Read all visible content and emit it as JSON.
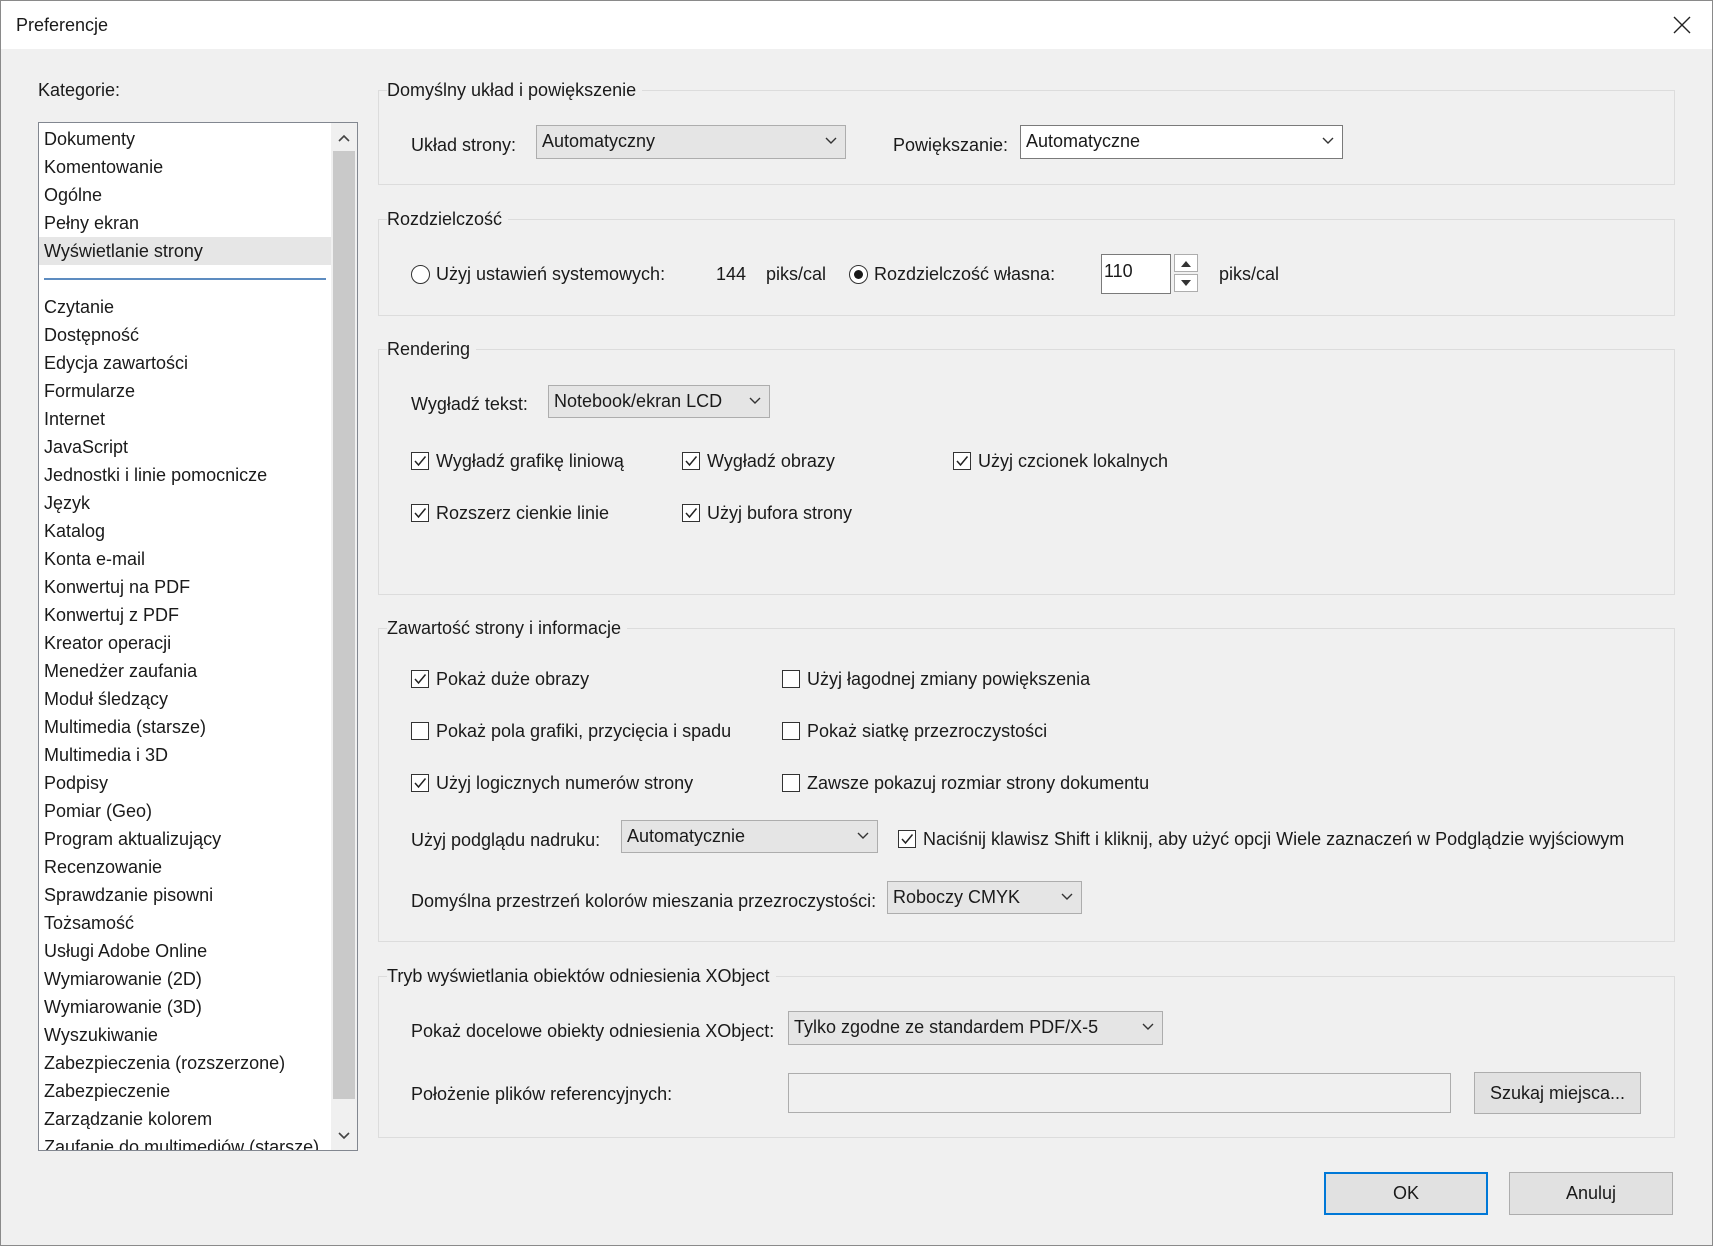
{
  "window": {
    "title": "Preferencje"
  },
  "categories": {
    "label": "Kategorie:",
    "top_items": [
      "Dokumenty",
      "Komentowanie",
      "Ogólne",
      "Pełny ekran",
      "Wyświetlanie strony"
    ],
    "items": [
      "Czytanie",
      "Dostępność",
      "Edycja zawartości",
      "Formularze",
      "Internet",
      "JavaScript",
      "Jednostki i linie pomocnicze",
      "Język",
      "Katalog",
      "Konta e-mail",
      "Konwertuj na PDF",
      "Konwertuj z PDF",
      "Kreator operacji",
      "Menedżer zaufania",
      "Moduł śledzący",
      "Multimedia (starsze)",
      "Multimedia i 3D",
      "Podpisy",
      "Pomiar (Geo)",
      "Program aktualizujący",
      "Recenzowanie",
      "Sprawdzanie pisowni",
      "Tożsamość",
      "Usługi Adobe Online",
      "Wymiarowanie (2D)",
      "Wymiarowanie (3D)",
      "Wyszukiwanie",
      "Zabezpieczenia (rozszerzone)",
      "Zabezpieczenie",
      "Zarządzanie kolorem",
      "Zaufanie do multimediów (starsze)"
    ],
    "selected": "Wyświetlanie strony"
  },
  "layout_zoom": {
    "title": "Domyślny układ i powiększenie",
    "page_layout_label": "Układ strony:",
    "page_layout_value": "Automatyczny",
    "zoom_label": "Powiększanie:",
    "zoom_value": "Automatyczne"
  },
  "resolution": {
    "title": "Rozdzielczość",
    "system_label": "Użyj ustawień systemowych:",
    "system_value": "144",
    "unit": "piks/cal",
    "custom_label": "Rozdzielczość własna:",
    "custom_value": "110",
    "custom_unit": "piks/cal",
    "selected": "custom"
  },
  "rendering": {
    "title": "Rendering",
    "smooth_text_label": "Wygładź tekst:",
    "smooth_text_value": "Notebook/ekran LCD",
    "smooth_line_art": {
      "label": "Wygładź grafikę liniową",
      "checked": true
    },
    "smooth_images": {
      "label": "Wygładź obrazy",
      "checked": true
    },
    "local_fonts": {
      "label": "Użyj czcionek lokalnych",
      "checked": true
    },
    "enhance_thin_lines": {
      "label": "Rozszerz cienkie linie",
      "checked": true
    },
    "page_cache": {
      "label": "Użyj bufora strony",
      "checked": true
    }
  },
  "page_content": {
    "title": "Zawartość strony i informacje",
    "show_large_images": {
      "label": "Pokaż duże obrazy",
      "checked": true
    },
    "smooth_zoom": {
      "label": "Użyj łagodnej zmiany powiększenia",
      "checked": false
    },
    "show_art_trim_bleed": {
      "label": "Pokaż pola grafiki, przycięcia i spadu",
      "checked": false
    },
    "show_transparency_grid": {
      "label": "Pokaż siatkę przezroczystości",
      "checked": false
    },
    "logical_page_numbers": {
      "label": "Użyj logicznych numerów strony",
      "checked": true
    },
    "always_show_doc_size": {
      "label": "Zawsze pokazuj rozmiar strony dokumentu",
      "checked": false
    },
    "overprint_label": "Użyj podglądu nadruku:",
    "overprint_value": "Automatycznie",
    "shift_click": {
      "label": "Naciśnij klawisz Shift i kliknij, aby użyć opcji Wiele zaznaczeń w Podglądzie wyjściowym",
      "checked": true
    },
    "blend_space_label": "Domyślna przestrzeń kolorów mieszania przezroczystości:",
    "blend_space_value": "Roboczy CMYK"
  },
  "xobject": {
    "title": "Tryb wyświetlania obiektów odniesienia XObject",
    "show_label": "Pokaż docelowe obiekty odniesienia XObject:",
    "show_value": "Tylko zgodne ze standardem PDF/X-5",
    "ref_files_label": "Położenie plików referencyjnych:",
    "ref_files_value": "",
    "browse_button": "Szukaj miejsca..."
  },
  "footer": {
    "ok": "OK",
    "cancel": "Anuluj"
  }
}
